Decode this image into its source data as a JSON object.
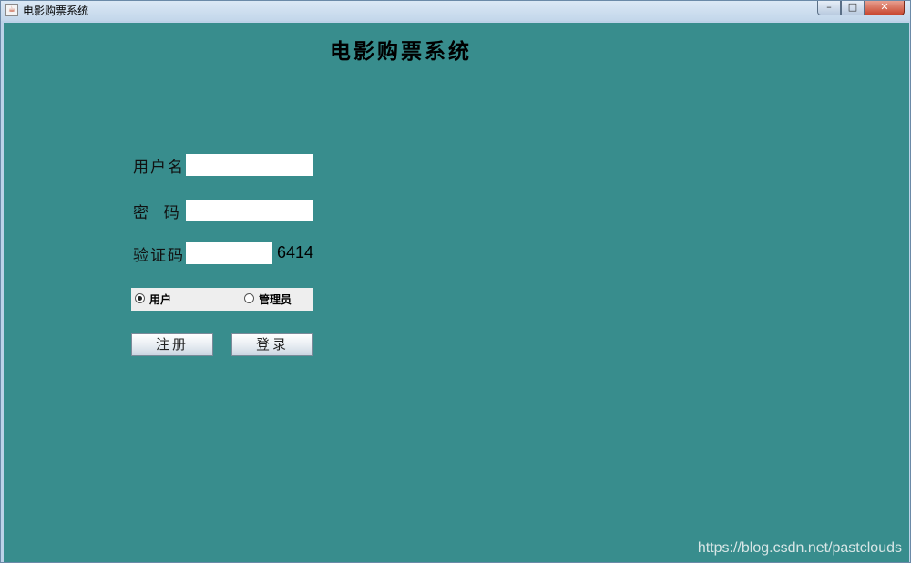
{
  "window": {
    "title": "电影购票系统",
    "app_icon_glyph": "☕"
  },
  "app": {
    "heading": "电影购票系统"
  },
  "form": {
    "username_label": "用户名",
    "username_value": "",
    "password_label": "密  码",
    "password_value": "",
    "captcha_label": "验证码",
    "captcha_value": "",
    "captcha_code": "6414"
  },
  "role": {
    "options": [
      {
        "label": "用户",
        "selected": true
      },
      {
        "label": "管理员",
        "selected": false
      }
    ]
  },
  "actions": {
    "register_label": "注册",
    "login_label": "登录"
  },
  "watermark": "https://blog.csdn.net/pastclouds",
  "colors": {
    "background": "#388d8d",
    "field_bg": "#ffffff",
    "radio_panel_bg": "#eeeeee"
  }
}
